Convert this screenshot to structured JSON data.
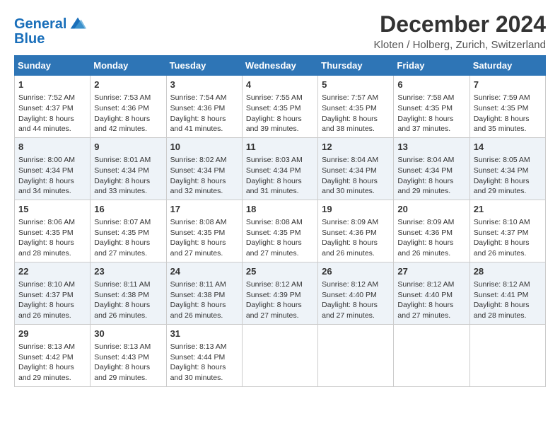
{
  "header": {
    "logo_line1": "General",
    "logo_line2": "Blue",
    "month": "December 2024",
    "location": "Kloten / Holberg, Zurich, Switzerland"
  },
  "weekdays": [
    "Sunday",
    "Monday",
    "Tuesday",
    "Wednesday",
    "Thursday",
    "Friday",
    "Saturday"
  ],
  "weeks": [
    [
      {
        "day": "1",
        "sunrise": "Sunrise: 7:52 AM",
        "sunset": "Sunset: 4:37 PM",
        "daylight": "Daylight: 8 hours and 44 minutes."
      },
      {
        "day": "2",
        "sunrise": "Sunrise: 7:53 AM",
        "sunset": "Sunset: 4:36 PM",
        "daylight": "Daylight: 8 hours and 42 minutes."
      },
      {
        "day": "3",
        "sunrise": "Sunrise: 7:54 AM",
        "sunset": "Sunset: 4:36 PM",
        "daylight": "Daylight: 8 hours and 41 minutes."
      },
      {
        "day": "4",
        "sunrise": "Sunrise: 7:55 AM",
        "sunset": "Sunset: 4:35 PM",
        "daylight": "Daylight: 8 hours and 39 minutes."
      },
      {
        "day": "5",
        "sunrise": "Sunrise: 7:57 AM",
        "sunset": "Sunset: 4:35 PM",
        "daylight": "Daylight: 8 hours and 38 minutes."
      },
      {
        "day": "6",
        "sunrise": "Sunrise: 7:58 AM",
        "sunset": "Sunset: 4:35 PM",
        "daylight": "Daylight: 8 hours and 37 minutes."
      },
      {
        "day": "7",
        "sunrise": "Sunrise: 7:59 AM",
        "sunset": "Sunset: 4:35 PM",
        "daylight": "Daylight: 8 hours and 35 minutes."
      }
    ],
    [
      {
        "day": "8",
        "sunrise": "Sunrise: 8:00 AM",
        "sunset": "Sunset: 4:34 PM",
        "daylight": "Daylight: 8 hours and 34 minutes."
      },
      {
        "day": "9",
        "sunrise": "Sunrise: 8:01 AM",
        "sunset": "Sunset: 4:34 PM",
        "daylight": "Daylight: 8 hours and 33 minutes."
      },
      {
        "day": "10",
        "sunrise": "Sunrise: 8:02 AM",
        "sunset": "Sunset: 4:34 PM",
        "daylight": "Daylight: 8 hours and 32 minutes."
      },
      {
        "day": "11",
        "sunrise": "Sunrise: 8:03 AM",
        "sunset": "Sunset: 4:34 PM",
        "daylight": "Daylight: 8 hours and 31 minutes."
      },
      {
        "day": "12",
        "sunrise": "Sunrise: 8:04 AM",
        "sunset": "Sunset: 4:34 PM",
        "daylight": "Daylight: 8 hours and 30 minutes."
      },
      {
        "day": "13",
        "sunrise": "Sunrise: 8:04 AM",
        "sunset": "Sunset: 4:34 PM",
        "daylight": "Daylight: 8 hours and 29 minutes."
      },
      {
        "day": "14",
        "sunrise": "Sunrise: 8:05 AM",
        "sunset": "Sunset: 4:34 PM",
        "daylight": "Daylight: 8 hours and 29 minutes."
      }
    ],
    [
      {
        "day": "15",
        "sunrise": "Sunrise: 8:06 AM",
        "sunset": "Sunset: 4:35 PM",
        "daylight": "Daylight: 8 hours and 28 minutes."
      },
      {
        "day": "16",
        "sunrise": "Sunrise: 8:07 AM",
        "sunset": "Sunset: 4:35 PM",
        "daylight": "Daylight: 8 hours and 27 minutes."
      },
      {
        "day": "17",
        "sunrise": "Sunrise: 8:08 AM",
        "sunset": "Sunset: 4:35 PM",
        "daylight": "Daylight: 8 hours and 27 minutes."
      },
      {
        "day": "18",
        "sunrise": "Sunrise: 8:08 AM",
        "sunset": "Sunset: 4:35 PM",
        "daylight": "Daylight: 8 hours and 27 minutes."
      },
      {
        "day": "19",
        "sunrise": "Sunrise: 8:09 AM",
        "sunset": "Sunset: 4:36 PM",
        "daylight": "Daylight: 8 hours and 26 minutes."
      },
      {
        "day": "20",
        "sunrise": "Sunrise: 8:09 AM",
        "sunset": "Sunset: 4:36 PM",
        "daylight": "Daylight: 8 hours and 26 minutes."
      },
      {
        "day": "21",
        "sunrise": "Sunrise: 8:10 AM",
        "sunset": "Sunset: 4:37 PM",
        "daylight": "Daylight: 8 hours and 26 minutes."
      }
    ],
    [
      {
        "day": "22",
        "sunrise": "Sunrise: 8:10 AM",
        "sunset": "Sunset: 4:37 PM",
        "daylight": "Daylight: 8 hours and 26 minutes."
      },
      {
        "day": "23",
        "sunrise": "Sunrise: 8:11 AM",
        "sunset": "Sunset: 4:38 PM",
        "daylight": "Daylight: 8 hours and 26 minutes."
      },
      {
        "day": "24",
        "sunrise": "Sunrise: 8:11 AM",
        "sunset": "Sunset: 4:38 PM",
        "daylight": "Daylight: 8 hours and 26 minutes."
      },
      {
        "day": "25",
        "sunrise": "Sunrise: 8:12 AM",
        "sunset": "Sunset: 4:39 PM",
        "daylight": "Daylight: 8 hours and 27 minutes."
      },
      {
        "day": "26",
        "sunrise": "Sunrise: 8:12 AM",
        "sunset": "Sunset: 4:40 PM",
        "daylight": "Daylight: 8 hours and 27 minutes."
      },
      {
        "day": "27",
        "sunrise": "Sunrise: 8:12 AM",
        "sunset": "Sunset: 4:40 PM",
        "daylight": "Daylight: 8 hours and 27 minutes."
      },
      {
        "day": "28",
        "sunrise": "Sunrise: 8:12 AM",
        "sunset": "Sunset: 4:41 PM",
        "daylight": "Daylight: 8 hours and 28 minutes."
      }
    ],
    [
      {
        "day": "29",
        "sunrise": "Sunrise: 8:13 AM",
        "sunset": "Sunset: 4:42 PM",
        "daylight": "Daylight: 8 hours and 29 minutes."
      },
      {
        "day": "30",
        "sunrise": "Sunrise: 8:13 AM",
        "sunset": "Sunset: 4:43 PM",
        "daylight": "Daylight: 8 hours and 29 minutes."
      },
      {
        "day": "31",
        "sunrise": "Sunrise: 8:13 AM",
        "sunset": "Sunset: 4:44 PM",
        "daylight": "Daylight: 8 hours and 30 minutes."
      },
      null,
      null,
      null,
      null
    ]
  ]
}
